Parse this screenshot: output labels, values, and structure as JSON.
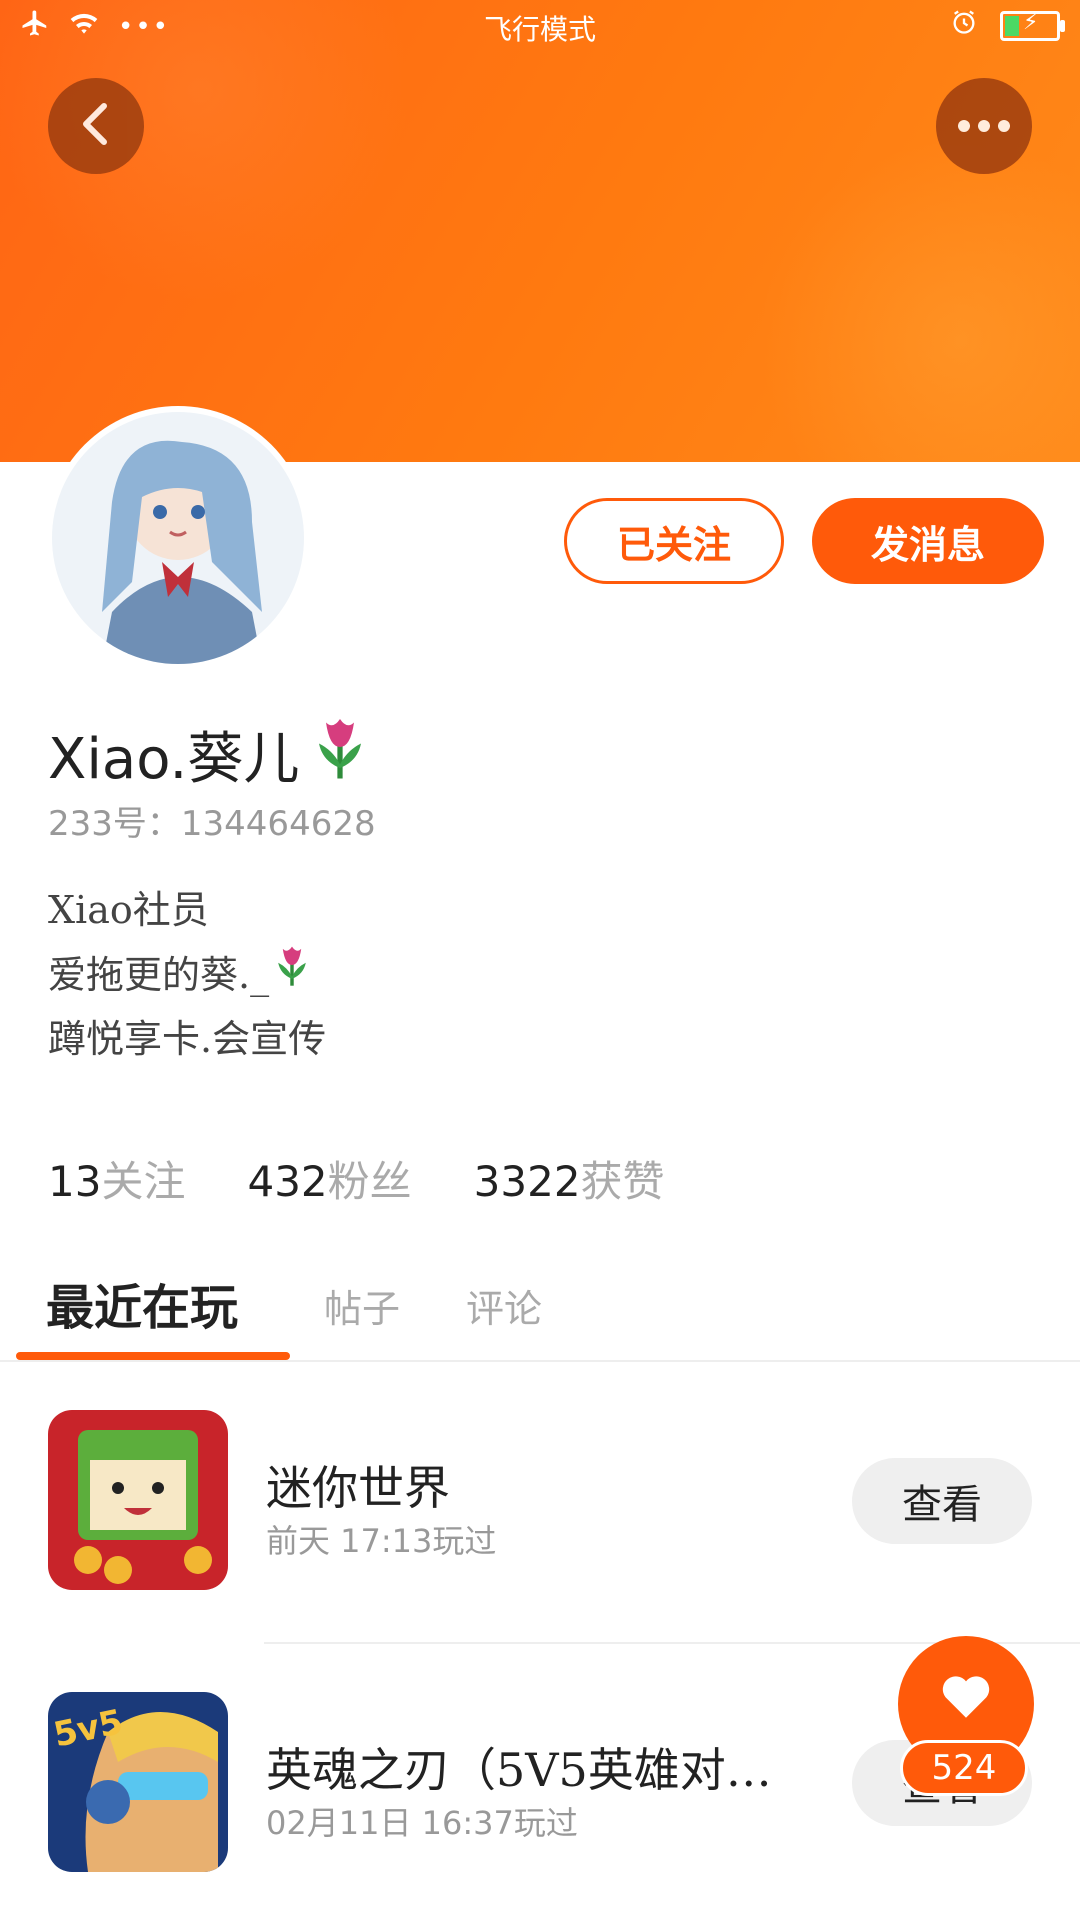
{
  "status_bar": {
    "center_text": "飞行模式",
    "icons": [
      "airplane-icon",
      "wifi-icon",
      "more-dots-icon",
      "alarm-icon",
      "battery-charging-icon"
    ]
  },
  "header": {
    "back_icon": "chevron-left-icon",
    "more_icon": "more-horizontal-icon",
    "accent_color": "#ff5a0a"
  },
  "profile": {
    "follow_button": "已关注",
    "message_button": "发消息",
    "username": "Xiao.葵儿",
    "username_emoji": "tulip-emoji",
    "id_label": "233号：",
    "id_value": "134464628",
    "bio": {
      "line1": "Xiao社员",
      "line2": "爱拖更的葵._",
      "line3": "蹲悦享卡.会宣传"
    }
  },
  "stats": {
    "following_num": "13",
    "following_label": "关注",
    "fans_num": "432",
    "fans_label": "粉丝",
    "likes_num": "3322",
    "likes_label": "获赞"
  },
  "tabs": {
    "active": "最近在玩",
    "tab2": "帖子",
    "tab3": "评论"
  },
  "games": [
    {
      "title": "迷你世界",
      "time": "前天 17:13玩过",
      "action": "查看"
    },
    {
      "title": "英魂之刃（5V5英雄对…",
      "time": "02月11日 16:37玩过",
      "action": "查看"
    }
  ],
  "like_fab": {
    "count": "524"
  }
}
